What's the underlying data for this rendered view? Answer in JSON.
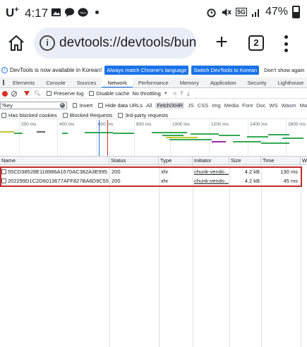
{
  "status_bar": {
    "carrier": "U",
    "carrier_sup": "+",
    "time": "4:17",
    "network": "5G",
    "battery": "47%",
    "battery_level": 0.47
  },
  "browser": {
    "url": "devtools://devtools/bunc",
    "tab_count": "2"
  },
  "infobar": {
    "message": "DevTools is now available in Korean!",
    "btn_match": "Always match Chrome's language",
    "btn_switch": "Switch DevTools to Korean",
    "btn_dismiss": "Don't show again"
  },
  "devtools_tabs": [
    "Elements",
    "Console",
    "Sources",
    "Network",
    "Performance",
    "Memory",
    "Application",
    "Security",
    "Lighthouse"
  ],
  "active_tab": "Network",
  "toolbar": {
    "preserve_log": "Preserve log",
    "disable_cache": "Disable cache",
    "throttling": "No throttling"
  },
  "filter": {
    "value": "?key",
    "invert": "Invert",
    "hide_data_urls": "Hide data URLs",
    "types": [
      "All",
      "Fetch/XHR",
      "JS",
      "CSS",
      "Img",
      "Media",
      "Font",
      "Doc",
      "WS",
      "Wasm",
      "Ma"
    ],
    "active_type": "Fetch/XHR",
    "has_blocked_cookies": "Has blocked cookies",
    "blocked_requests": "Blocked Requests",
    "third_party": "3rd-party requests"
  },
  "overview": {
    "ticks": [
      "200 ms",
      "400 ms",
      "600 ms",
      "800 ms",
      "1000 ms",
      "1200 ms",
      "1400 ms",
      "1600 ms"
    ]
  },
  "table": {
    "columns": [
      "Name",
      "Status",
      "Type",
      "Initiator",
      "Size",
      "Time",
      "Wa"
    ],
    "rows": [
      {
        "name": "55CD38528E118986A1670AC382A3E995...",
        "status": "200",
        "type": "xhr",
        "initiator": "chunk-vendo...",
        "size": "4.2 kB",
        "time": "130 ms"
      },
      {
        "name": "202299D1C2D6013677AFF827BA6D9C55...",
        "status": "200",
        "type": "xhr",
        "initiator": "chunk-vendo...",
        "size": "4.2 kB",
        "time": "45 ms"
      }
    ]
  },
  "colors": {
    "accent": "#1a73e8",
    "record": "#d93025",
    "highlight_border": "#c62828",
    "waterfall_green": "#34a853",
    "waterfall_purple": "#9c27b0",
    "waterfall_yellow": "#c0ca33"
  }
}
